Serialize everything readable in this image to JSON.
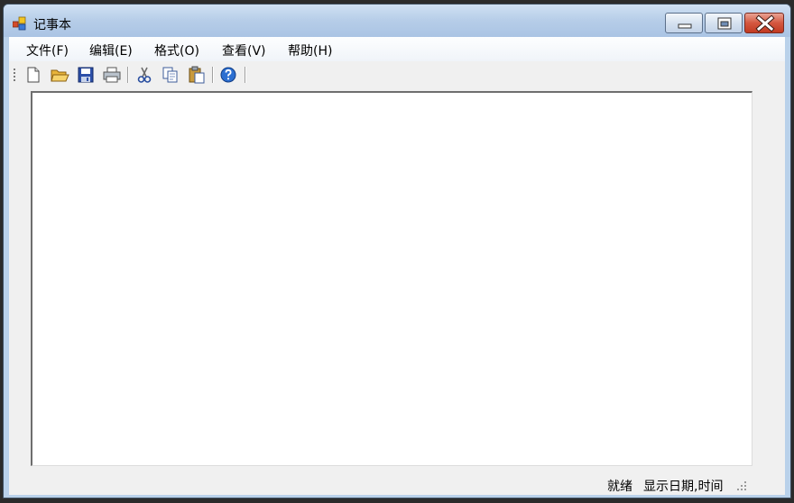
{
  "window": {
    "title": "记事本",
    "app_icon": "app-windows-icon",
    "controls": [
      "minimize-icon",
      "maximize-icon",
      "close-icon"
    ]
  },
  "menu": {
    "items": [
      {
        "label": "文件(F)"
      },
      {
        "label": "编辑(E)"
      },
      {
        "label": "格式(O)"
      },
      {
        "label": "查看(V)"
      },
      {
        "label": "帮助(H)"
      }
    ]
  },
  "toolbar": {
    "buttons": [
      "new-file-icon",
      "open-folder-icon",
      "save-icon",
      "print-icon",
      "cut-icon",
      "copy-icon",
      "paste-icon",
      "help-icon"
    ]
  },
  "editor": {
    "content": ""
  },
  "statusbar": {
    "ready": "就绪",
    "datetime": "显示日期,时间"
  },
  "colors": {
    "title_gradient_top": "#cfe0f3",
    "title_gradient_bottom": "#aac4e4",
    "client_bg": "#f0f0f0",
    "close_button": "#c13a22",
    "help_icon_blue": "#2c6fd1"
  }
}
